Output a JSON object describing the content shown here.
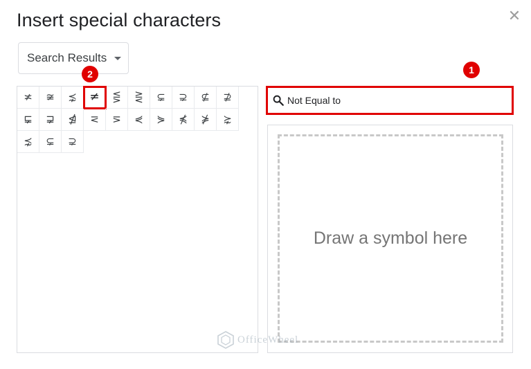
{
  "dialog": {
    "title": "Insert special characters",
    "close_glyph": "✕"
  },
  "dropdown": {
    "selected": "Search Results"
  },
  "grid": {
    "columns": 10,
    "cells": [
      "≭",
      "≆",
      "⋨",
      "≠",
      "⋚",
      "⋛",
      "⊊",
      "⊋",
      "⊈",
      "⊉",
      "⋤",
      "⋥",
      "⋬",
      "⋜",
      "⋝",
      "⋞",
      "⋟",
      "⋠",
      "⋡",
      "⋩",
      "⋨",
      "⊊",
      "⊋"
    ],
    "highlighted_index": 3
  },
  "search": {
    "value": "Not Equal to",
    "placeholder": "Search"
  },
  "draw": {
    "label": "Draw a symbol here"
  },
  "annotations": {
    "badge_1": "1",
    "badge_2": "2",
    "color": "#e00000"
  },
  "watermark": {
    "text": "OfficeWheel"
  },
  "colors": {
    "accent_red": "#e00000",
    "border": "#dadce0",
    "text": "#202124"
  }
}
